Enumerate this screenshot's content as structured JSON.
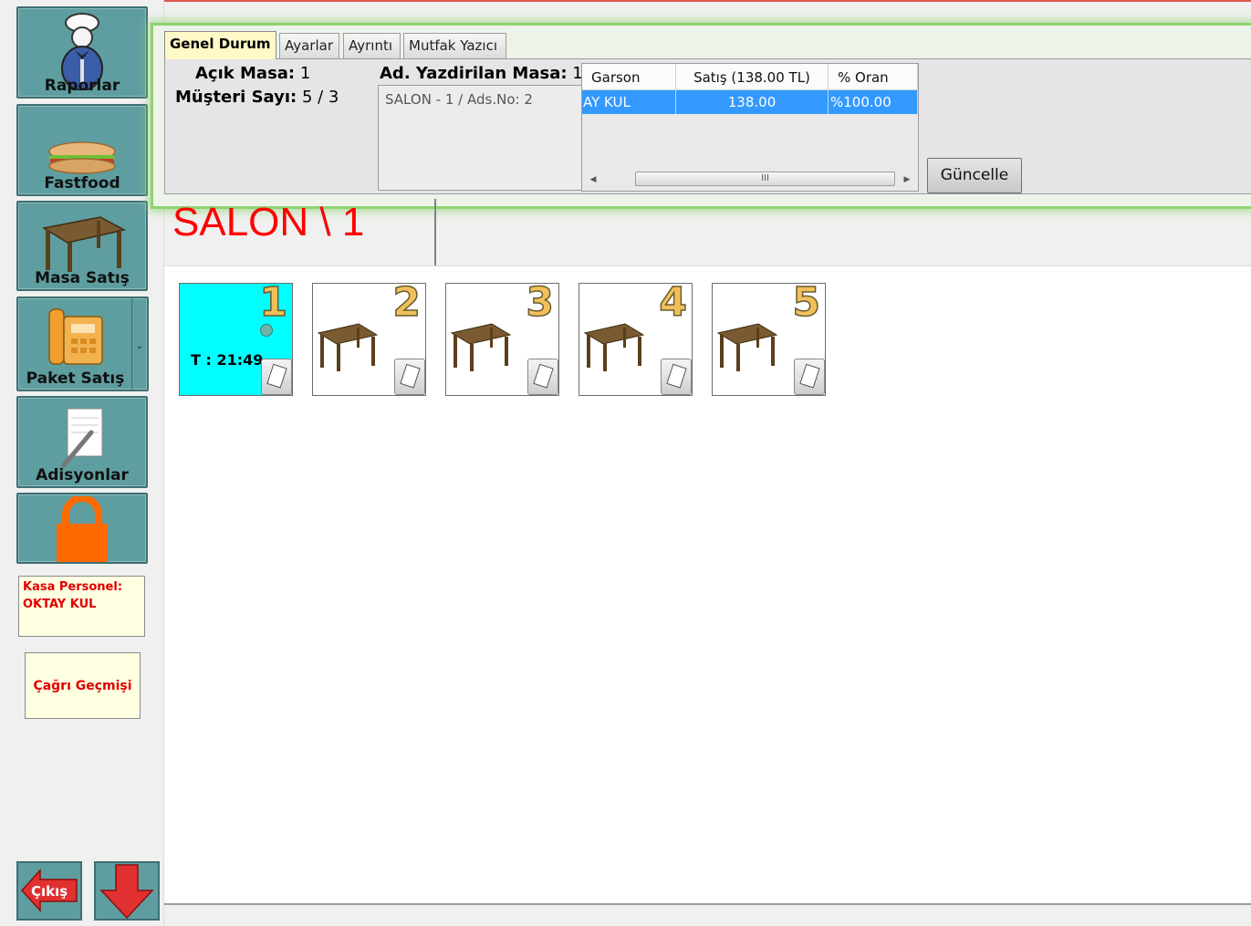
{
  "sidebar": {
    "buttons": [
      {
        "label": "Raporlar",
        "icon": "waiter-icon"
      },
      {
        "label": "Fastfood",
        "icon": "sandwich-icon"
      },
      {
        "label": "Masa Satış",
        "icon": "table-icon"
      },
      {
        "label": "Paket Satış",
        "icon": "phone-icon"
      },
      {
        "label": "Adisyonlar",
        "icon": "notepad-pen-icon"
      },
      {
        "label": "",
        "icon": "lock-icon"
      }
    ],
    "kasa_label": "Kasa Personel:",
    "kasa_name": "OKTAY KUL",
    "cagri_label": "Çağrı Geçmişi",
    "exit_label": "Çıkış"
  },
  "tabs": [
    "Genel Durum",
    "Ayarlar",
    "Ayrıntı",
    "Mutfak Yazıcı"
  ],
  "status": {
    "acik_masa_label": "Açık Masa:",
    "acik_masa_value": "1",
    "musteri_label": "Müşteri Sayı:",
    "musteri_value": "5 / 3",
    "ad_yazdirilan_label": "Ad. Yazdirilan Masa:",
    "ad_yazdirilan_value": "1",
    "list_items": [
      "SALON - 1 / Ads.No: 2"
    ]
  },
  "grid": {
    "headers": [
      "Garson",
      "Satış (138.00 TL)",
      "% Oran"
    ],
    "rows": [
      [
        "AY KUL",
        "138.00",
        "%100.00"
      ]
    ],
    "scroll_thumb": "III"
  },
  "guncelle_label": "Güncelle",
  "salon_title": "SALON \\ 1",
  "tables": [
    {
      "number": "1",
      "active": true,
      "timer": "T : 21:49"
    },
    {
      "number": "2",
      "active": false,
      "timer": ""
    },
    {
      "number": "3",
      "active": false,
      "timer": ""
    },
    {
      "number": "4",
      "active": false,
      "timer": ""
    },
    {
      "number": "5",
      "active": false,
      "timer": ""
    }
  ],
  "colors": {
    "accent_teal": "#5f9ea0",
    "active_table": "#00ffff",
    "title_red": "#ff0000",
    "selection_blue": "#3399ff",
    "glow_green": "#8fd36e"
  }
}
